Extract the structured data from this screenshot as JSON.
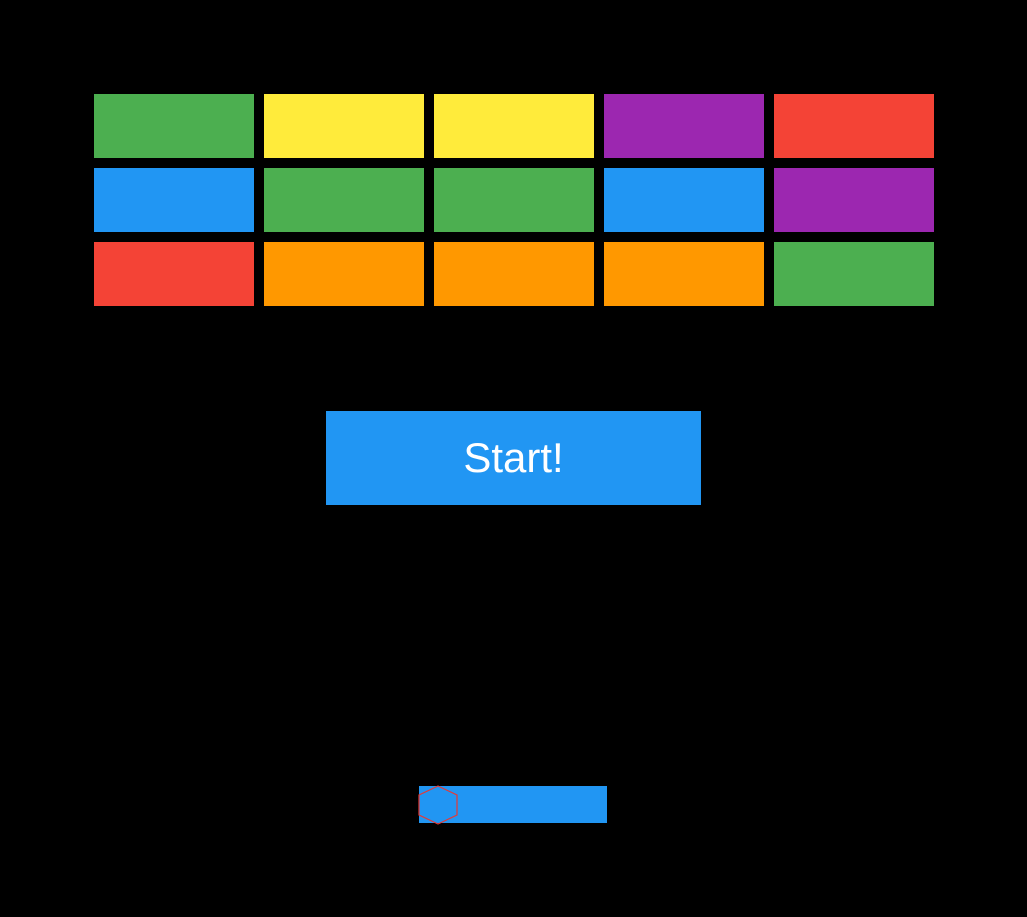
{
  "background_color": "#000000",
  "bricks": {
    "colors": {
      "green": "#4caf50",
      "yellow": "#ffeb3b",
      "purple": "#9c27b0",
      "red": "#f44336",
      "blue": "#2196f3",
      "orange": "#ff9800"
    },
    "rows": [
      [
        "green",
        "yellow",
        "yellow",
        "purple",
        "red"
      ],
      [
        "blue",
        "green",
        "green",
        "blue",
        "purple"
      ],
      [
        "red",
        "orange",
        "orange",
        "orange",
        "green"
      ]
    ]
  },
  "start_button": {
    "label": "Start!",
    "background_color": "#2196f3",
    "text_color": "#ffffff"
  },
  "paddle": {
    "color": "#2196f3"
  },
  "ball": {
    "icon": "hexagon-ball-icon",
    "outline_color": "#e53935"
  }
}
